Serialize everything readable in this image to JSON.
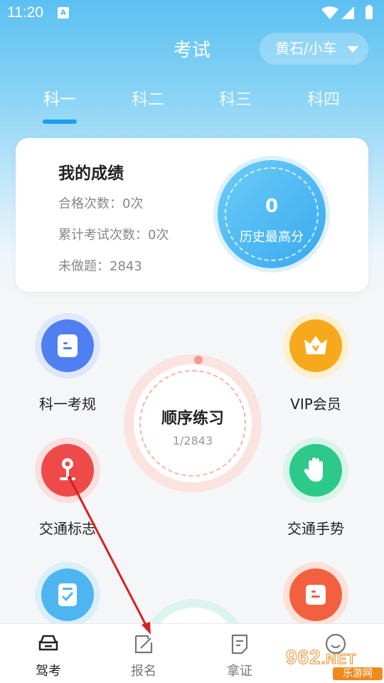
{
  "status_bar": {
    "time": "11:20",
    "notification_icon": "A"
  },
  "header": {
    "title": "考试",
    "location": "黄石/小车"
  },
  "tabs": [
    {
      "label": "科一",
      "active": true
    },
    {
      "label": "科二"
    },
    {
      "label": "科三"
    },
    {
      "label": "科四"
    }
  ],
  "score_card": {
    "title": "我的成绩",
    "pass_count": "合格次数：0次",
    "exam_count": "累计考试次数：0次",
    "undone": "未做题：2843",
    "best_score": "0",
    "best_label": "历史最高分"
  },
  "features": {
    "rules": "科一考规",
    "vip": "VIP会员",
    "signs": "交通标志",
    "gestures": "交通手势"
  },
  "practice": {
    "title": "顺序练习",
    "progress": "1/2843"
  },
  "bottom_nav": [
    {
      "label": "驾考",
      "icon": "car-icon",
      "active": true
    },
    {
      "label": "报名",
      "icon": "edit-icon"
    },
    {
      "label": "拿证",
      "icon": "document-icon"
    },
    {
      "label": "",
      "icon": "smile-icon"
    }
  ],
  "watermark": {
    "logo": "962",
    "domain": ".NET",
    "sub": "乐游网"
  },
  "colors": {
    "accent": "#1e9ff0",
    "rules_blue": "#4f7ff0",
    "vip_orange": "#f7a81c",
    "signs_red": "#ee4a4a",
    "gesture_green": "#2cc98a",
    "note_blue": "#4fb5f0",
    "note_red": "#f2603f"
  }
}
